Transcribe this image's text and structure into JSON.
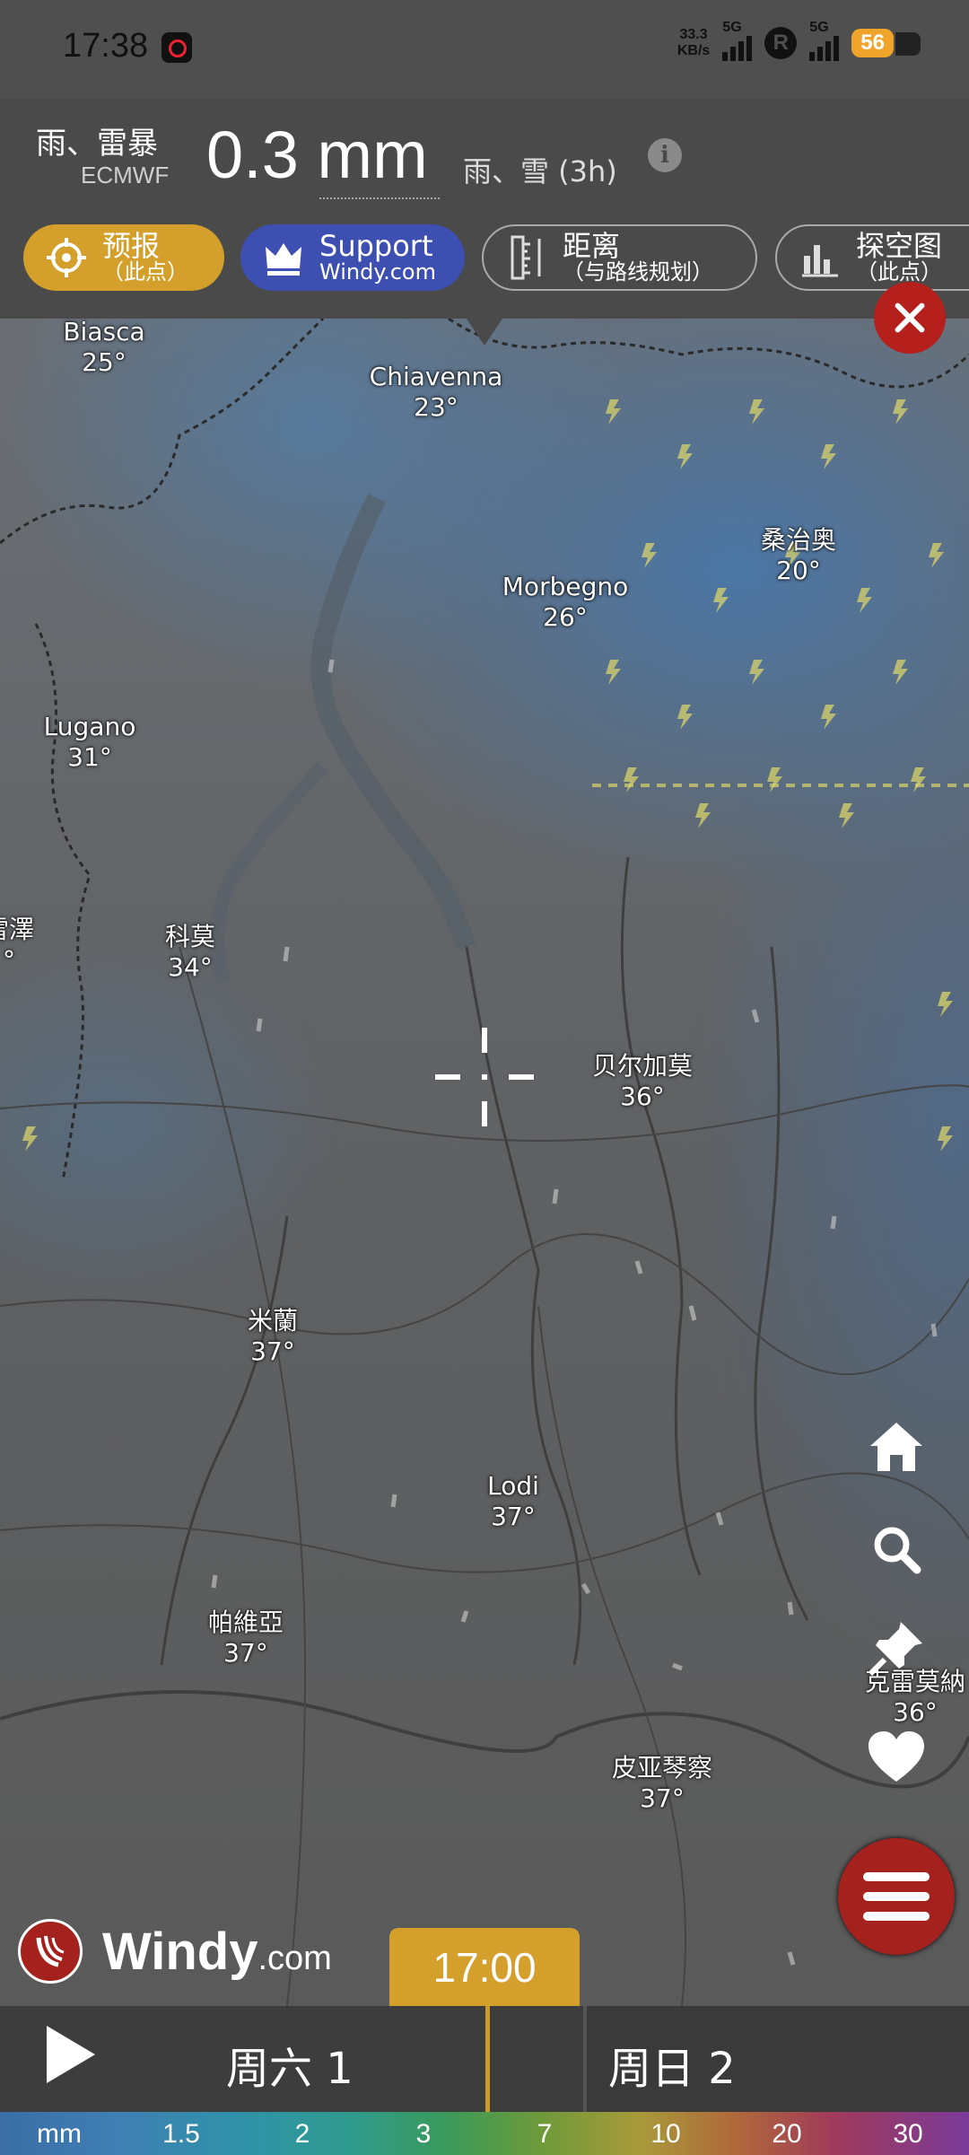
{
  "status_bar": {
    "time": "17:38",
    "net_speed_top": "33.3",
    "net_speed_bottom": "KB/s",
    "network1": "5G",
    "network2": "5G",
    "r_badge": "R",
    "battery": "56"
  },
  "header": {
    "layer_name": "雨、雷暴",
    "model": "ECMWF",
    "value": "0.3 mm",
    "description": "雨、雪 (3h)",
    "info": "i"
  },
  "pills": {
    "forecast_l1": "预报",
    "forecast_l2": "（此点）",
    "support_l1": "Support",
    "support_l2": "Windy.com",
    "distance_l1": "距离",
    "distance_l2": "（与路线规划）",
    "sounding_l1": "探空图",
    "sounding_l2": "（此点）"
  },
  "cities": [
    {
      "name": "Biasca",
      "temp": "25°"
    },
    {
      "name": "Chiavenna",
      "temp": "23°"
    },
    {
      "name": "桑治奥",
      "temp": "20°"
    },
    {
      "name": "Morbegno",
      "temp": "26°"
    },
    {
      "name": "Lugano",
      "temp": "31°"
    },
    {
      "name": "雷澤",
      "temp": "°"
    },
    {
      "name": "科莫",
      "temp": "34°"
    },
    {
      "name": "贝尔加莫",
      "temp": "36°"
    },
    {
      "name": "米蘭",
      "temp": "37°"
    },
    {
      "name": "Lodi",
      "temp": "37°"
    },
    {
      "name": "帕維亞",
      "temp": "37°"
    },
    {
      "name": "皮亚琴察",
      "temp": "37°"
    },
    {
      "name": "克雷莫納",
      "temp": "36°"
    }
  ],
  "brand": {
    "name": "Windy",
    "suffix": ".com"
  },
  "timeline": {
    "current_time": "17:00",
    "day1": "周六 1",
    "day2": "周日 2"
  },
  "legend": {
    "unit": "mm",
    "ticks": [
      "1.5",
      "2",
      "3",
      "7",
      "10",
      "20",
      "30"
    ]
  },
  "colors": {
    "accent_gold": "#d4a02b",
    "support_blue": "#3d4fb0",
    "menu_red": "#a5211d"
  },
  "icons": [
    "forecast-target-icon",
    "crown-icon",
    "ruler-icon",
    "bar-chart-icon",
    "close-icon",
    "home-icon",
    "search-icon",
    "pin-icon",
    "heart-icon",
    "menu-icon",
    "play-icon",
    "windy-logo-icon",
    "info-icon"
  ]
}
